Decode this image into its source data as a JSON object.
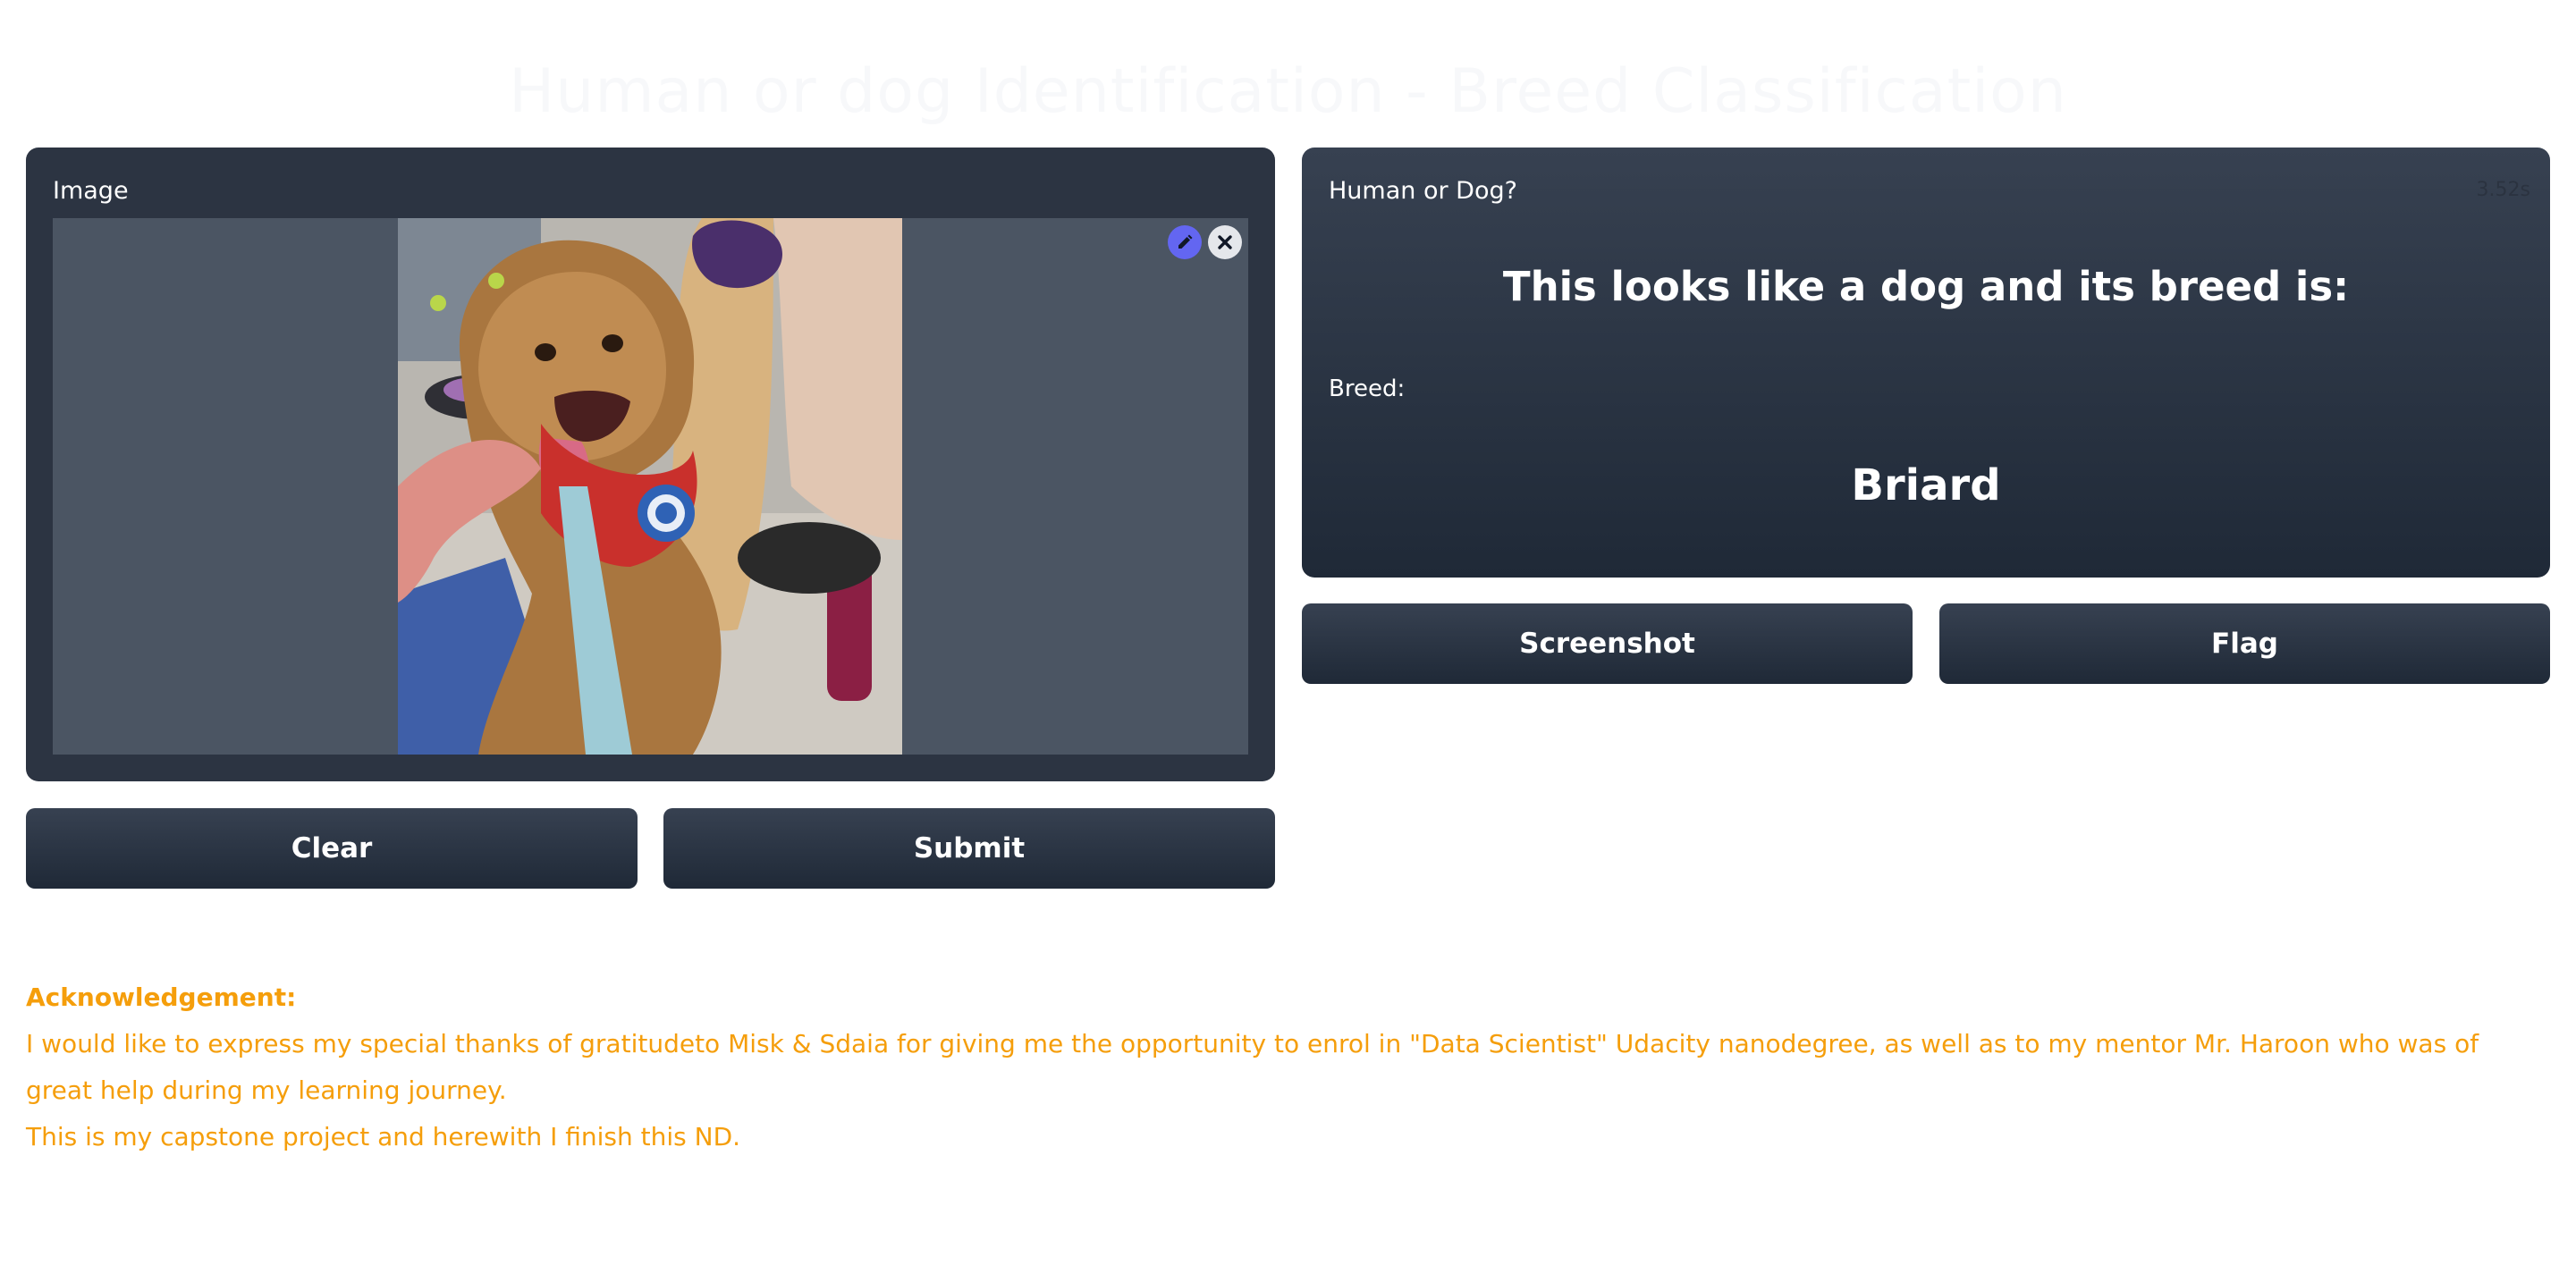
{
  "page": {
    "title": "Human or dog Identification - Breed Classification"
  },
  "input": {
    "label": "Image",
    "image_alt": "dog",
    "clear_label": "Clear",
    "submit_label": "Submit"
  },
  "output": {
    "label": "Human or Dog?",
    "timer": "3.52s",
    "heading": "This looks like a dog and its breed is:",
    "breed_label": "Breed:",
    "breed_value": "Briard",
    "screenshot_label": "Screenshot",
    "flag_label": "Flag"
  },
  "acknowledgement": {
    "title": "Acknowledgement:",
    "line1": "I would like to express my special thanks of gratitudeto Misk & Sdaia for giving me the opportunity to enrol in \"Data Scientist\" Udacity nanodegree, as well as to my mentor Mr. Haroon who was of great help during my learning journey.",
    "line2": "This is my capstone project and herewith I finish this ND."
  },
  "colors": {
    "accent": "#f59e0b",
    "panel_top": "#374151",
    "panel_bottom": "#1f2937",
    "edit_button": "#6366f1"
  },
  "icons": {
    "edit": "pencil-icon",
    "remove": "close-icon"
  }
}
